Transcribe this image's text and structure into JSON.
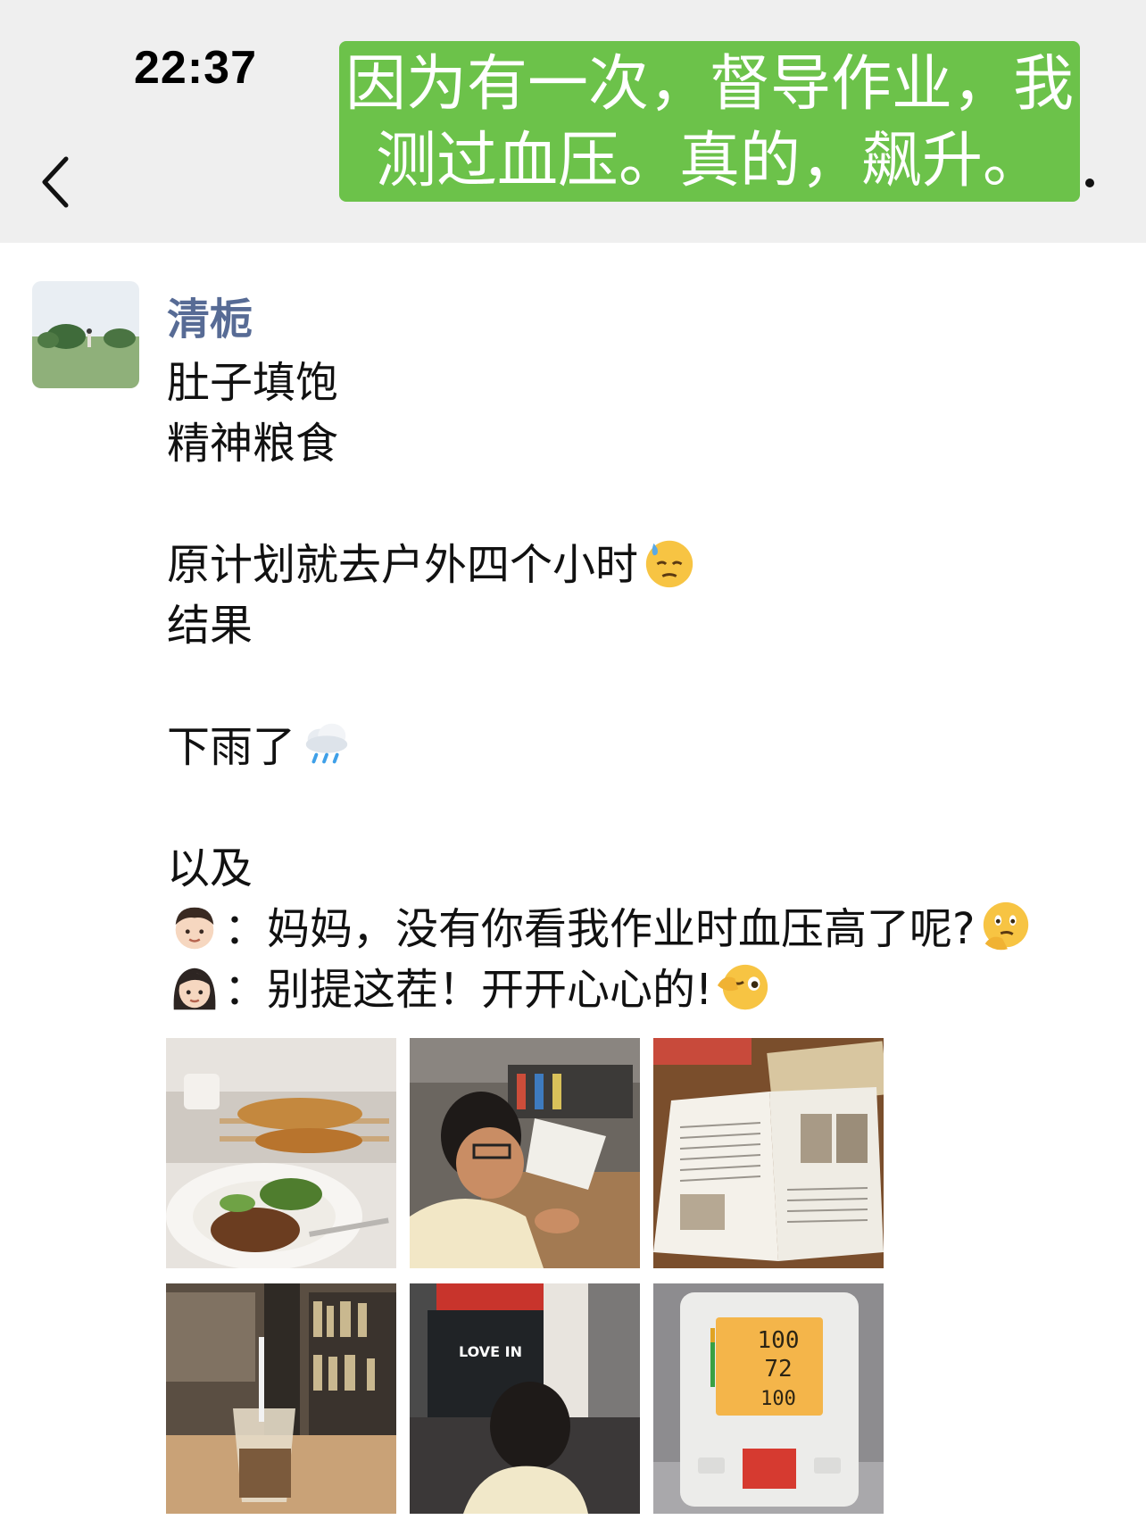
{
  "status_bar": {
    "time": "22:37"
  },
  "caption": {
    "line1": "因为有一次，督导作业，我",
    "line2": "测过血压。真的，飙升。"
  },
  "post": {
    "username": "清栀",
    "lines": {
      "l1": "肚子填饱",
      "l2": "精神粮食",
      "l3": "原计划就去户外四个小时",
      "l4": "结果",
      "l5": "下雨了",
      "l6": "以及",
      "l7": "：妈妈，没有你看我作业时血压高了呢?",
      "l8": "：别提这茬！开开心心的!"
    },
    "emojis": [
      "sweat-emoji",
      "rain-cloud-emoji",
      "boy-emoji",
      "thinking-emoji",
      "woman-emoji",
      "wink-emoji"
    ]
  },
  "photos": {
    "p5_sign": "LOVE IN",
    "monitor": {
      "sys": "100",
      "dia": "72",
      "pulse": "100"
    }
  },
  "colors": {
    "caption_bg": "#6cc24a",
    "username": "#576b95",
    "topbar_bg": "#efefef"
  }
}
